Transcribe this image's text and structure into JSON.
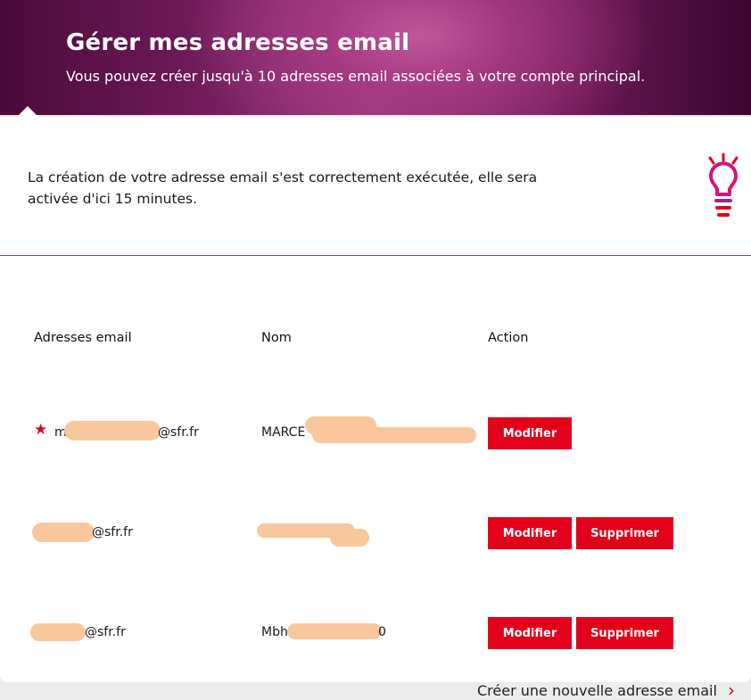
{
  "header": {
    "title": "Gérer mes adresses email",
    "subtitle": "Vous pouvez créer jusqu'à 10 adresses email associées à votre compte principal."
  },
  "notice": {
    "message": "La création de votre adresse email s'est correctement exécutée, elle sera activée d'ici 15 minutes.",
    "icon": "lightbulb-icon"
  },
  "table": {
    "headers": {
      "email": "Adresses email",
      "name": "Nom",
      "action": "Action"
    },
    "rows": [
      {
        "email_prefix": "m",
        "email_suffix": "@sfr.fr",
        "name": "MARCE",
        "primary": true,
        "modify": "Modifier"
      },
      {
        "email_prefix": "",
        "email_suffix": "@sfr.fr",
        "name": "",
        "primary": false,
        "modify": "Modifier",
        "delete": "Supprimer"
      },
      {
        "email_prefix": "",
        "email_suffix": "@sfr.fr",
        "name": "Mbh",
        "name_end": "0",
        "primary": false,
        "modify": "Modifier",
        "delete": "Supprimer"
      }
    ]
  },
  "footer": {
    "create_link": "Créer une nouvelle adresse email"
  },
  "colors": {
    "accent": "#e2001a",
    "banner_dark": "#4a0a3a",
    "banner_light": "#c2559a"
  }
}
